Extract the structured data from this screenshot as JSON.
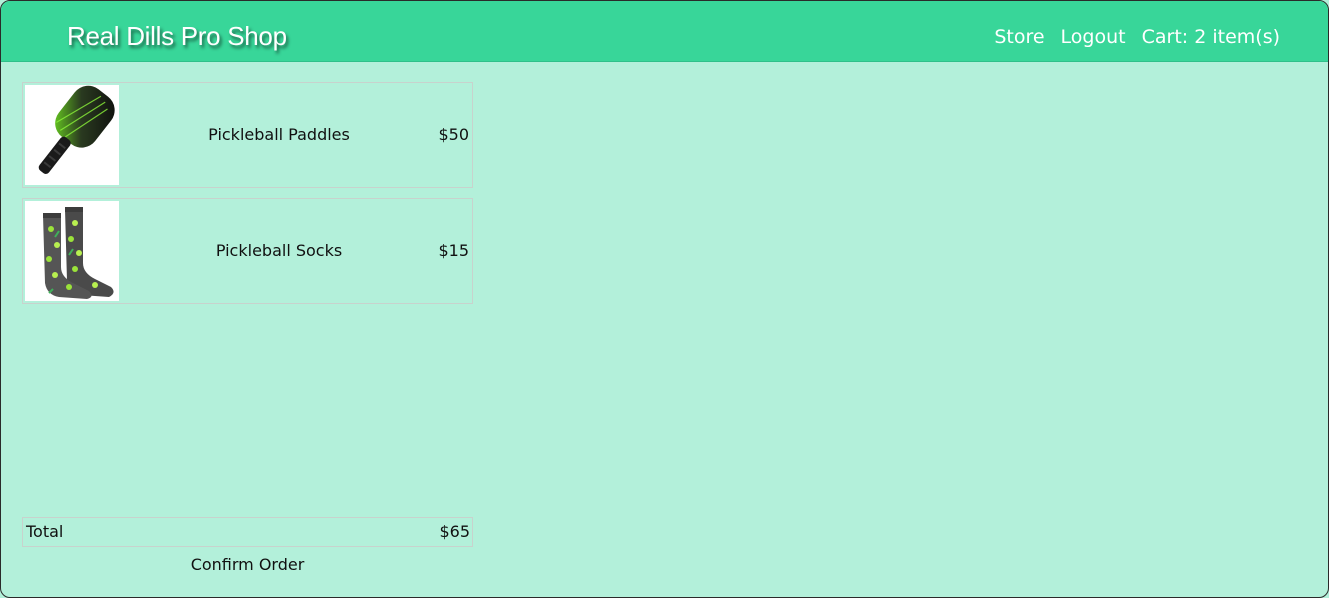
{
  "header": {
    "brand": "Real Dills Pro Shop",
    "nav": {
      "store": "Store",
      "logout": "Logout",
      "cart": "Cart: 2 item(s)"
    }
  },
  "cart": {
    "items": [
      {
        "name": "Pickleball Paddles",
        "price": "$50",
        "image": "paddle-image"
      },
      {
        "name": "Pickleball Socks",
        "price": "$15",
        "image": "socks-image"
      }
    ],
    "total_label": "Total",
    "total_value": "$65",
    "confirm_label": "Confirm Order"
  },
  "colors": {
    "navbar": "#38d699",
    "background": "#b3f0da",
    "text": "#111111",
    "nav_text": "#ffffff"
  }
}
